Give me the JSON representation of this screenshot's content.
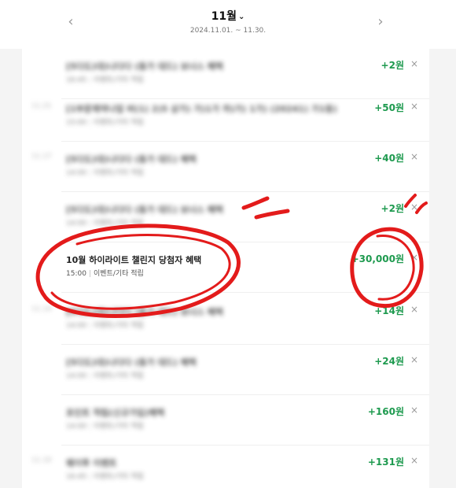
{
  "header": {
    "prev_icon": "chevron-left-icon",
    "next_icon": "chevron-right-icon",
    "month": "11월",
    "month_chevron": "⌄",
    "range": "2024.11.01. ~ 11.30."
  },
  "rows": [
    {
      "date": "",
      "title": "[5다도)대)나다다 (동가 대드) 보너스 혜택",
      "time": "16:45",
      "category": "이벤트/기타 적립",
      "amount": "+2원",
      "blurred": true
    },
    {
      "date": "11.21",
      "title": "[1부문제약나업 버(1) 2)5 상가) 가)1가 까)가) 1가) (20241) 가1등)",
      "time": "15:00",
      "category": "이벤트/기타 적립",
      "amount": "+50원",
      "blurred": true
    },
    {
      "date": "11.17",
      "title": "[5다도)대)나다다 (동가 대드) 혜택",
      "time": "14:00",
      "category": "이벤트/기타 적립",
      "amount": "+40원",
      "blurred": true
    },
    {
      "date": "",
      "title": "[5다도)대)나다다 (동가 대드) 보너스 혜택",
      "time": "14:00",
      "category": "이벤트/기타 적립",
      "amount": "+2원",
      "blurred": true
    },
    {
      "date": "",
      "title": "10월 하이라이트 챌린지 당첨자 혜택",
      "time": "15:00",
      "category": "이벤트/기타 적립",
      "amount": "+30,000원",
      "blurred": false
    },
    {
      "date": "11.14",
      "title": "[5다도)대)나다다 (동가 대드) 보너스 혜택",
      "time": "14:00",
      "category": "이벤트/기타 적립",
      "amount": "+14원",
      "blurred": true
    },
    {
      "date": "",
      "title": "[5다도)대)나다다 (동가 대드) 혜택",
      "time": "14:00",
      "category": "이벤트/기타 적립",
      "amount": "+24원",
      "blurred": true
    },
    {
      "date": "",
      "title": "포인트 적립(신규가입)혜택",
      "time": "14:00",
      "category": "이벤트/기타 적립",
      "amount": "+160원",
      "blurred": true
    },
    {
      "date": "11.10",
      "title": "웨이투 이벤트",
      "time": "16:45",
      "category": "이벤트/기타 적립",
      "amount": "+131원",
      "blurred": true
    }
  ],
  "close_glyph": "×",
  "colors": {
    "amount": "#1e9a4f",
    "annotation": "#e31b1b"
  }
}
